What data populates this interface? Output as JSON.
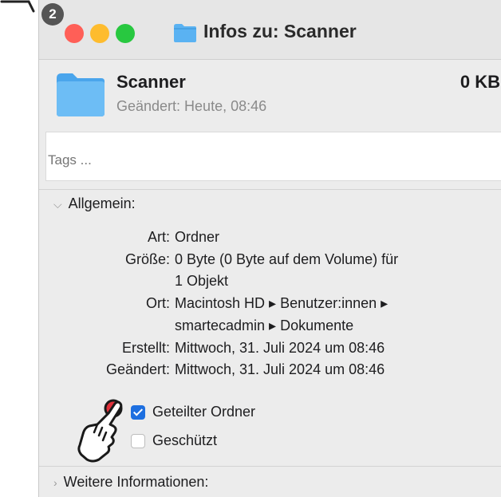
{
  "tutorial": {
    "step_number": "2"
  },
  "window": {
    "title": "Infos zu: Scanner"
  },
  "header": {
    "name": "Scanner",
    "size": "0 KB",
    "modified": "Geändert: Heute, 08:46"
  },
  "tags": {
    "placeholder": "Tags ..."
  },
  "general": {
    "heading": "Allgemein:",
    "rows": [
      {
        "label": "Art:",
        "lines": [
          "Ordner"
        ]
      },
      {
        "label": "Größe:",
        "lines": [
          "0 Byte (0 Byte auf dem Volume) für",
          "1 Objekt"
        ]
      },
      {
        "label": "Ort:",
        "lines": [
          "Macintosh HD ▸ Benutzer:innen ▸",
          "smartecadmin ▸ Dokumente"
        ]
      },
      {
        "label": "Erstellt:",
        "lines": [
          "Mittwoch, 31. Juli 2024 um 08:46"
        ]
      },
      {
        "label": "Geändert:",
        "lines": [
          "Mittwoch, 31. Juli 2024 um 08:46"
        ]
      }
    ],
    "shared_folder": {
      "label": "Geteilter Ordner",
      "checked": true
    },
    "locked": {
      "label": "Geschützt",
      "checked": false
    }
  },
  "more_info": {
    "heading": "Weitere Informationen:"
  },
  "colors": {
    "accent": "#1d6fe0",
    "folder": "#5ab2f2",
    "highlight": "#e0303a"
  }
}
